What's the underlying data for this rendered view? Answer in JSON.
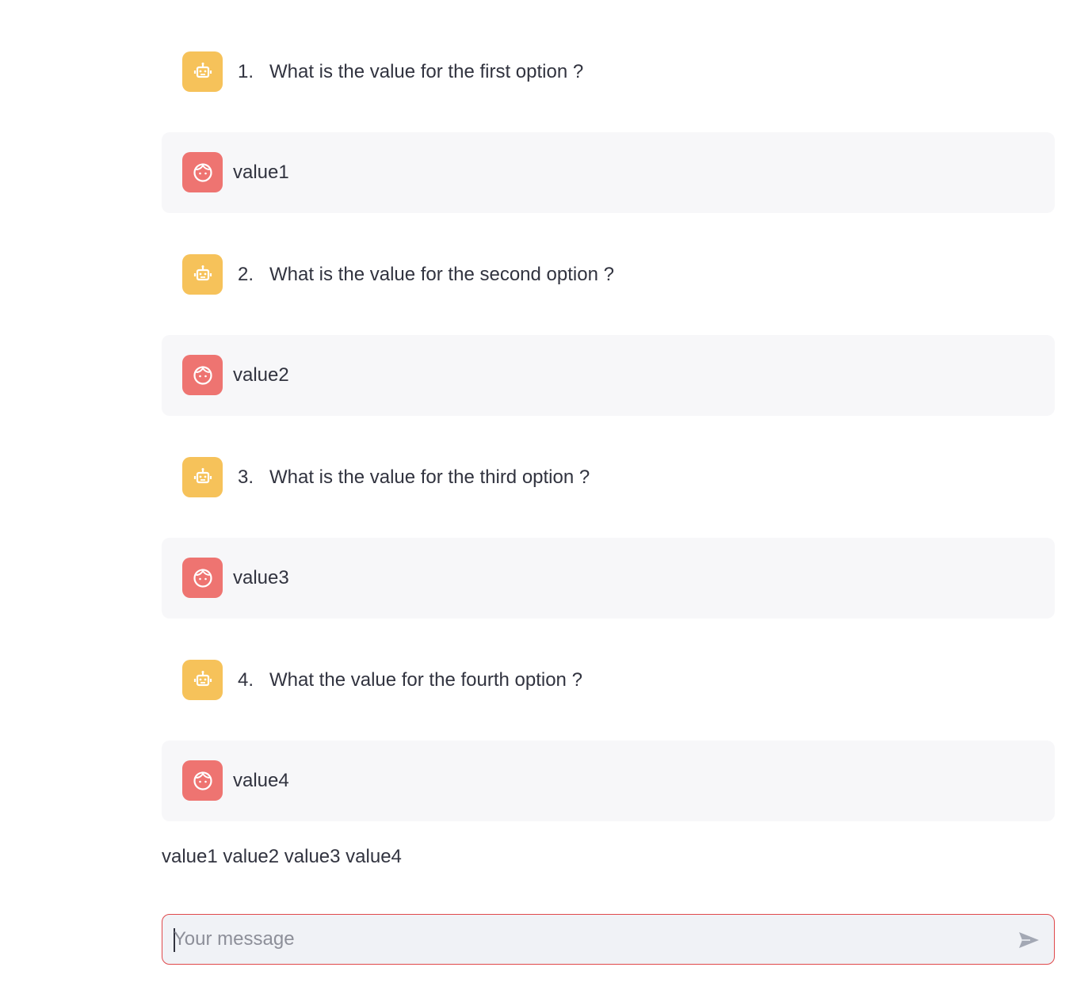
{
  "chat": {
    "messages": [
      {
        "role": "assistant",
        "avatar_icon": "robot-icon",
        "number": "1.",
        "text": "What is the value for the first option ?"
      },
      {
        "role": "user",
        "avatar_icon": "user-face-icon",
        "text": "value1"
      },
      {
        "role": "assistant",
        "avatar_icon": "robot-icon",
        "number": "2.",
        "text": "What is the value for the second option ?"
      },
      {
        "role": "user",
        "avatar_icon": "user-face-icon",
        "text": "value2"
      },
      {
        "role": "assistant",
        "avatar_icon": "robot-icon",
        "number": "3.",
        "text": "What is the value for the third option ?"
      },
      {
        "role": "user",
        "avatar_icon": "user-face-icon",
        "text": "value3"
      },
      {
        "role": "assistant",
        "avatar_icon": "robot-icon",
        "number": "4.",
        "text": "What the value for the fourth option ?"
      },
      {
        "role": "user",
        "avatar_icon": "user-face-icon",
        "text": "value4"
      }
    ]
  },
  "summary": {
    "text": "value1 value2 value3 value4"
  },
  "chat_input": {
    "placeholder": "Your message",
    "value": "",
    "send_icon": "send-arrow-icon"
  },
  "colors": {
    "assistant_avatar": "#f6c25a",
    "user_avatar": "#ee7471",
    "user_bubble": "#f7f7f9",
    "input_border": "#e0494b",
    "input_background": "#f0f2f6"
  }
}
